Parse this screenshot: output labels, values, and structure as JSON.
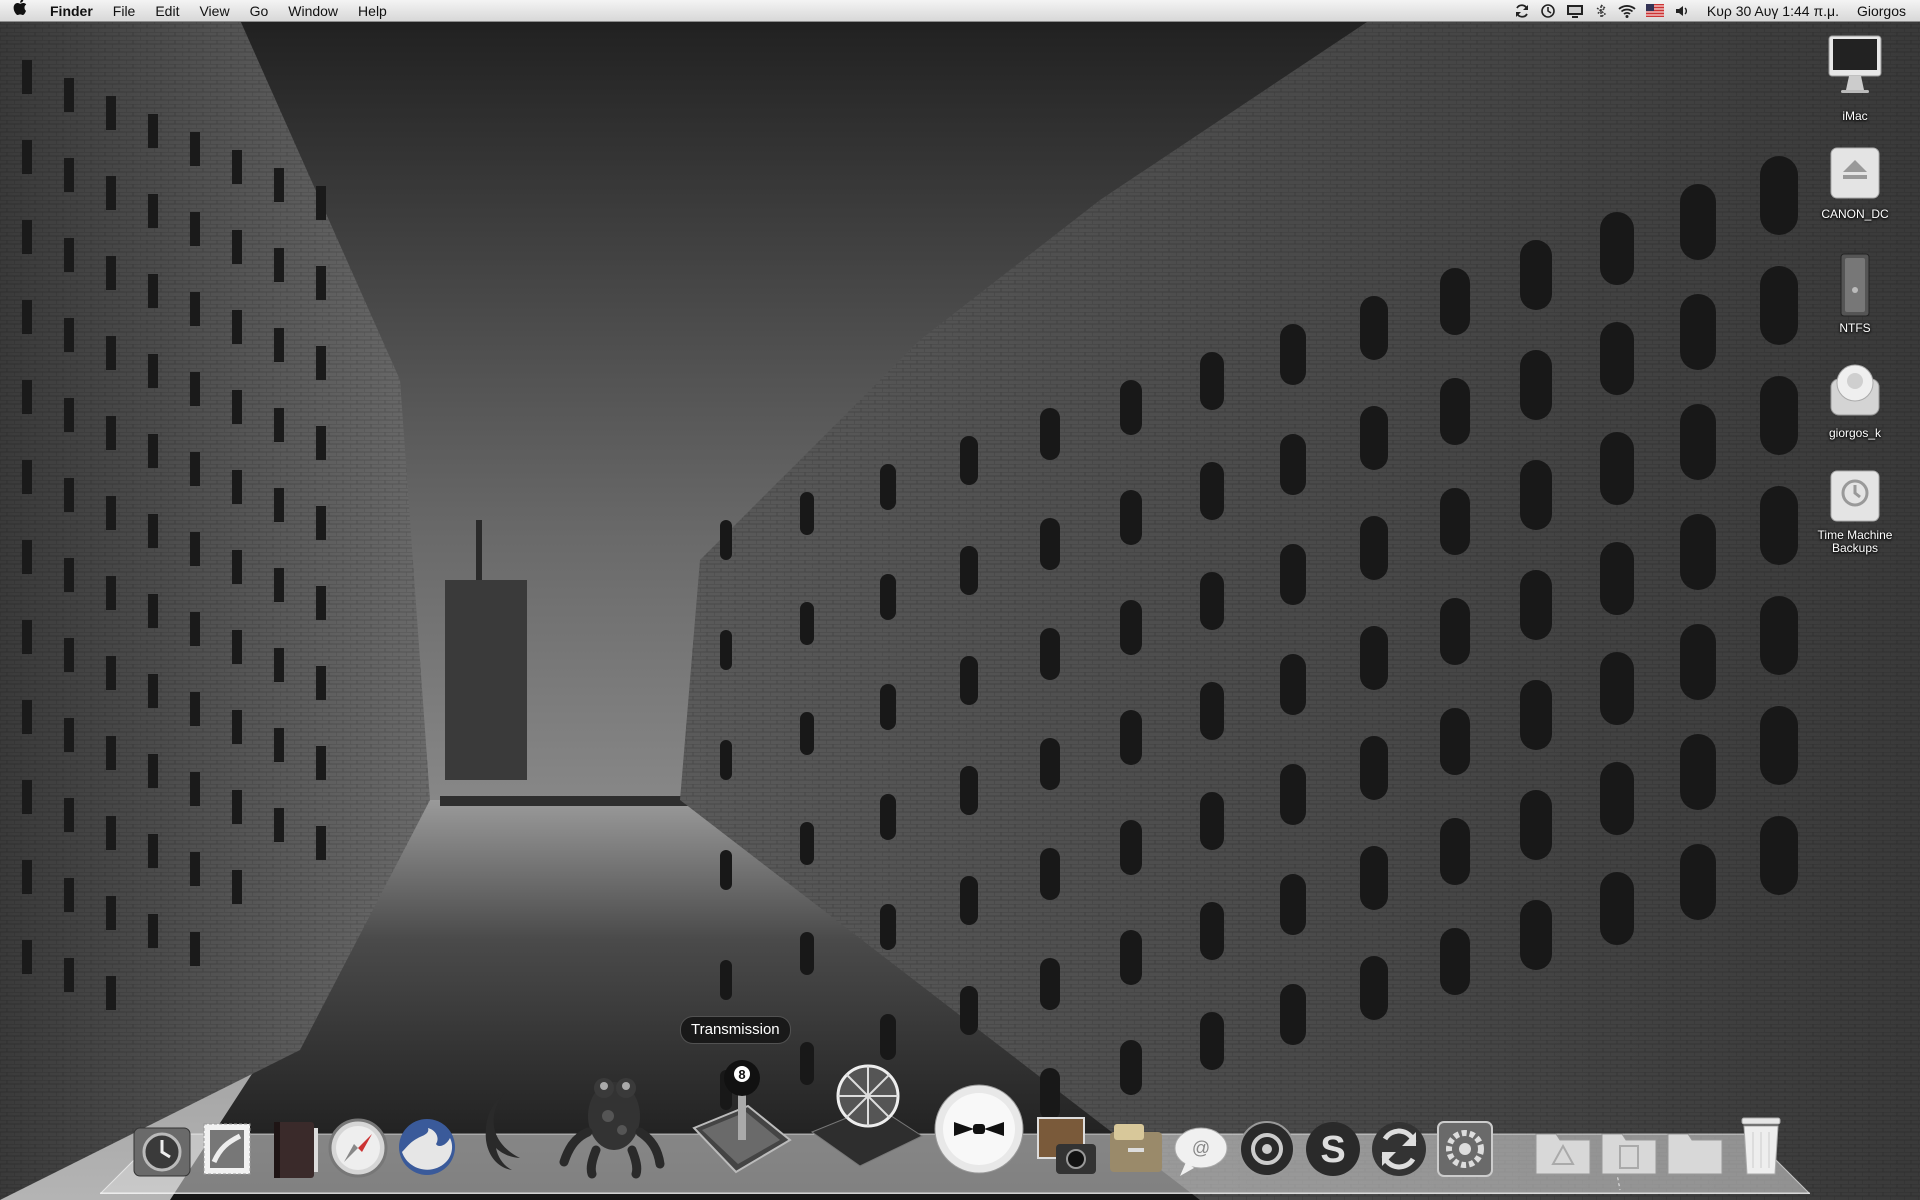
{
  "menubar": {
    "apple_icon": "apple-icon",
    "app_name": "Finder",
    "menus": [
      "File",
      "Edit",
      "View",
      "Go",
      "Window",
      "Help"
    ],
    "status_icons": [
      "sync-icon",
      "time-machine-icon",
      "display-icon",
      "bluetooth-icon",
      "wifi-icon",
      "us-flag-icon",
      "volume-icon"
    ],
    "clock": "Κυρ 30 Αυγ  1:44 π.μ.",
    "user": "Giorgos"
  },
  "desktop": {
    "icons": [
      {
        "label": "iMac",
        "icon": "imac-icon"
      },
      {
        "label": "CANON_DC",
        "icon": "eject-drive-icon"
      },
      {
        "label": "NTFS",
        "icon": "hard-drive-icon"
      },
      {
        "label": "giorgos_k",
        "icon": "user-drive-icon"
      },
      {
        "label": "Time Machine Backups",
        "icon": "time-machine-drive-icon"
      }
    ]
  },
  "dock": {
    "tooltip": "Transmission",
    "items": [
      "time-machine-app-icon",
      "mail-stamp-icon",
      "address-book-icon",
      "safari-icon",
      "firefox-icon",
      "camino-icon",
      "frog-app-icon",
      "transmission-icon",
      "aperture-icon",
      "bowtie-icon",
      "image-capture-icon",
      "file-cabinet-icon",
      "ichat-icon",
      "adium-icon",
      "skype-icon",
      "sync-app-icon",
      "system-preferences-icon",
      "applications-folder-icon",
      "documents-folder-icon",
      "downloads-folder-icon",
      "trash-icon"
    ]
  },
  "colors": {
    "menubar_top": "#f4f4f4",
    "menubar_bottom": "#d8d8d8",
    "sky": "#8a8a8a",
    "water": "#2a2a2a"
  }
}
